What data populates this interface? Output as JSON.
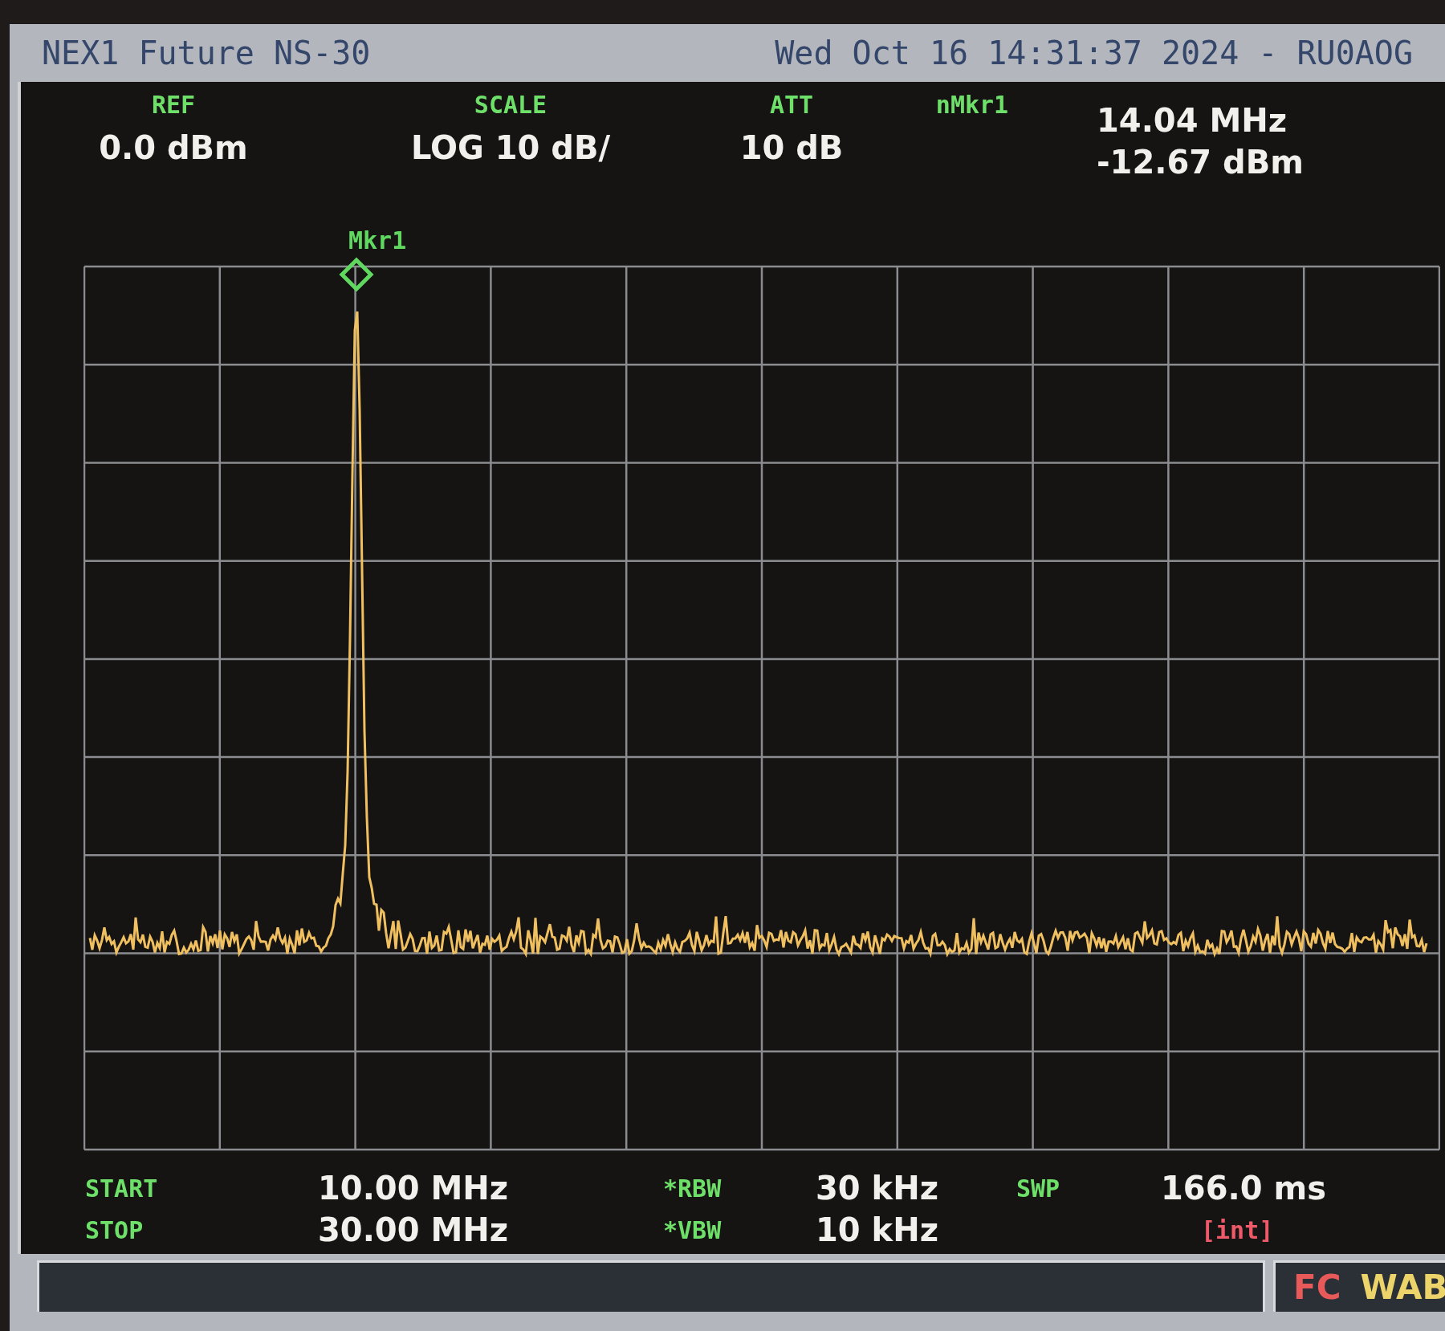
{
  "title_bar": {
    "instrument": "NEX1 Future NS-30",
    "datetime": "Wed Oct 16 14:31:37 2024 - RU0AOG"
  },
  "header": [
    {
      "label": "REF",
      "values": [
        "0.0 dBm"
      ]
    },
    {
      "label": "SCALE",
      "values": [
        "LOG 10 dB/"
      ]
    },
    {
      "label": "ATT",
      "values": [
        "10 dB"
      ]
    },
    {
      "label": "nMkr1"
    },
    {
      "values": [
        "14.04 MHz",
        "-12.67 dBm"
      ]
    }
  ],
  "marker": {
    "label": "Mkr1"
  },
  "footer": [
    {
      "kind": "reading",
      "label": "START",
      "value": "10.00 MHz"
    },
    {
      "kind": "reading",
      "label": "*RBW",
      "value": "30 kHz"
    },
    {
      "kind": "reading",
      "label": "SWP",
      "value": "166.0 ms"
    },
    {
      "kind": "reading",
      "label": "STOP",
      "value": "30.00 MHz"
    },
    {
      "kind": "reading",
      "label": "*VBW",
      "value": "10 kHz"
    },
    {
      "kind": "flag",
      "value": "[int]"
    }
  ],
  "status_bar": {
    "flags": [
      {
        "text": "FC",
        "color": "#e85a5a"
      },
      {
        "text": "WAB",
        "color": "#ecd36a"
      }
    ]
  }
}
